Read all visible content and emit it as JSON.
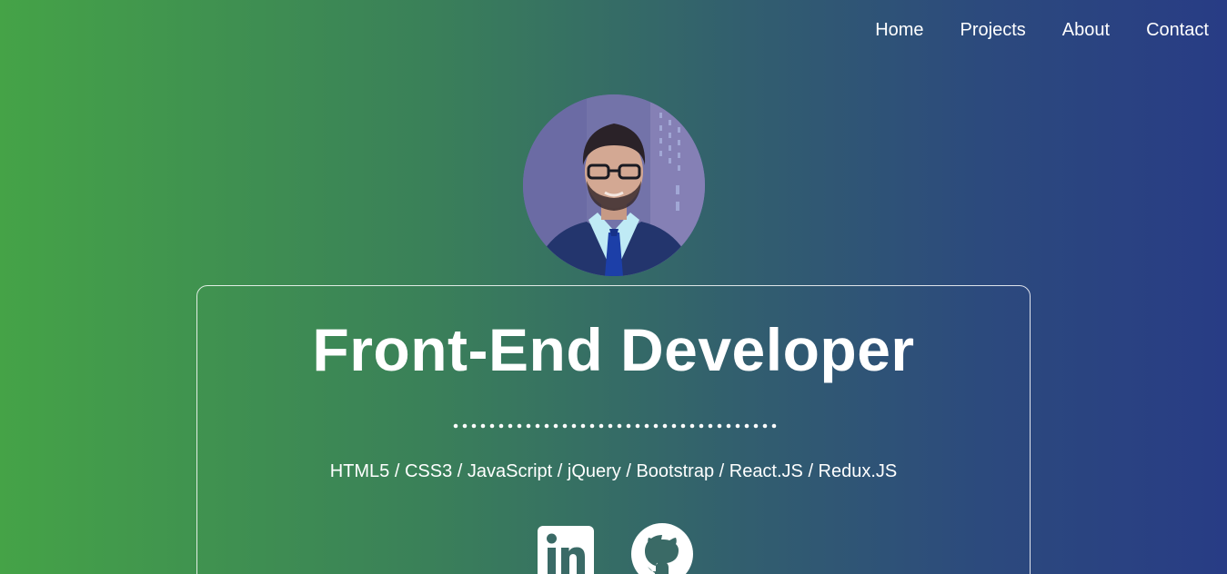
{
  "nav": {
    "items": [
      {
        "label": "Home"
      },
      {
        "label": "Projects"
      },
      {
        "label": "About"
      },
      {
        "label": "Contact"
      }
    ]
  },
  "hero": {
    "avatar_icon": "profile-photo",
    "title": "Front-End Developer",
    "skills": "HTML5 / CSS3 / JavaScript / jQuery / Bootstrap / React.JS / Redux.JS",
    "socials": [
      {
        "icon": "linkedin-icon"
      },
      {
        "icon": "github-icon"
      }
    ]
  },
  "colors": {
    "gradient_start": "#45a347",
    "gradient_end": "#283c85",
    "text": "#ffffff"
  }
}
